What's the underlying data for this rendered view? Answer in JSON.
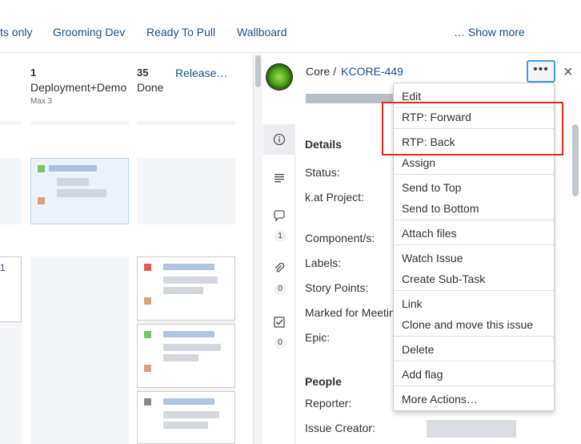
{
  "topbar": {
    "links": [
      "ts only",
      "Grooming Dev",
      "Ready To Pull",
      "Wallboard",
      "… Show more"
    ]
  },
  "board": {
    "columns": [
      {
        "count": "1",
        "name": "Deployment+Demo",
        "sub": "Max 3"
      },
      {
        "count": "35",
        "name": "Done"
      }
    ],
    "release_link": "Release…",
    "left_edge_mark": "1"
  },
  "detail": {
    "project": "Core /",
    "issue_key": "KCORE-449",
    "more_label": "•••",
    "close_label": "×",
    "sections": {
      "details": "Details",
      "people": "People"
    },
    "fields": [
      "Status:",
      "k.at Project:",
      "Component/s:",
      "Labels:",
      "Story Points:",
      "Marked for Meetin",
      "Epic:"
    ],
    "people_fields": [
      "Reporter:",
      "Issue Creator:"
    ],
    "rail_counts": [
      "1",
      "0",
      "0"
    ]
  },
  "menu": {
    "items": [
      "Edit",
      "RTP: Forward",
      "RTP: Back",
      "Assign",
      "Send to Top",
      "Send to Bottom",
      "Attach files",
      "Watch Issue",
      "Create Sub-Task",
      "Link",
      "Clone and move this issue",
      "Delete",
      "Add flag",
      "More Actions…"
    ]
  },
  "colors": {
    "link": "#205081",
    "highlight": "#e8261b",
    "focus": "#4a9ae1"
  },
  "icons": [
    "info-icon",
    "description-icon",
    "comment-icon",
    "attachment-icon",
    "subtask-icon",
    "close-icon"
  ]
}
